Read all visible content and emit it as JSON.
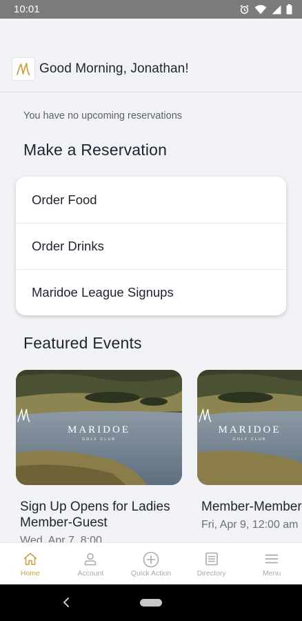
{
  "status_bar": {
    "time": "10:01",
    "icons": [
      "alarm-icon",
      "wifi-icon",
      "signal-icon",
      "battery-icon"
    ]
  },
  "header": {
    "logo_icon": "maridoe-m-logo",
    "greeting": "Good Morning, Jonathan!"
  },
  "reservations": {
    "empty_message": "You have no upcoming reservations"
  },
  "make_reservation": {
    "title": "Make a Reservation",
    "items": [
      {
        "label": "Order Food"
      },
      {
        "label": "Order Drinks"
      },
      {
        "label": "Maridoe League Signups"
      }
    ]
  },
  "featured_events": {
    "title": "Featured Events",
    "events": [
      {
        "brand": "MARIDOE",
        "brand_sub": "GOLF CLUB",
        "title_line1": "Sign Up Opens for Ladies",
        "title_line2": "Member-Guest",
        "date": "Wed, Apr 7, 8:00"
      },
      {
        "brand": "MARIDOE",
        "brand_sub": "GOLF CLUB",
        "title_line1": "Member-Member",
        "title_line2": "",
        "date": "Fri, Apr 9, 12:00 am"
      }
    ]
  },
  "bottom_nav": {
    "items": [
      {
        "label": "Home",
        "icon": "home-icon",
        "active": true
      },
      {
        "label": "Account",
        "icon": "person-icon",
        "active": false
      },
      {
        "label": "Quick Action",
        "icon": "plus-circle-icon",
        "active": false
      },
      {
        "label": "Directory",
        "icon": "directory-icon",
        "active": false
      },
      {
        "label": "Menu",
        "icon": "menu-icon",
        "active": false
      }
    ]
  },
  "colors": {
    "accent_gold": "#c9a03e",
    "background": "#f1f2f6",
    "text_primary": "#1f2330",
    "text_muted": "#a7a9b0"
  }
}
